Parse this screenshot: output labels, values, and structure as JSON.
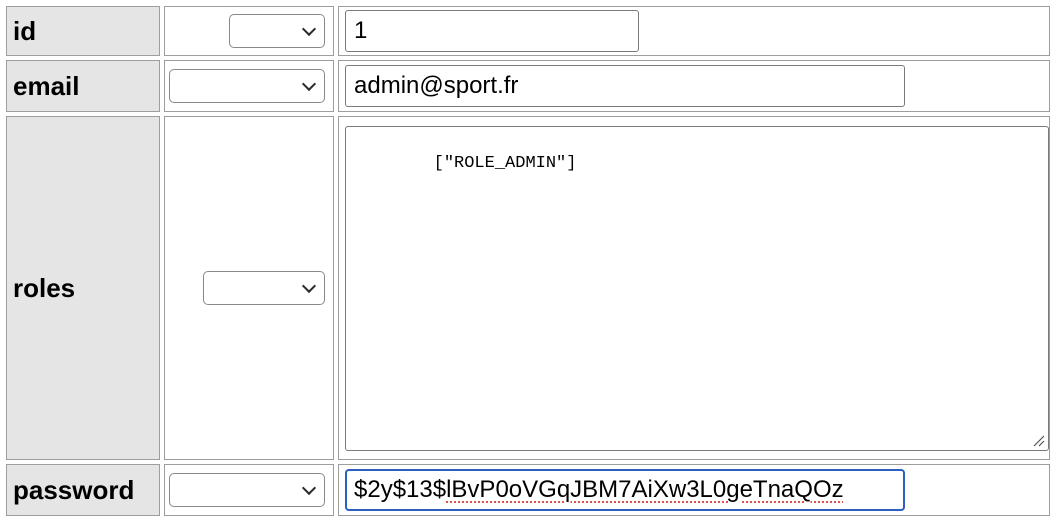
{
  "rows": [
    {
      "label": "id",
      "function_value": "",
      "value": "1"
    },
    {
      "label": "email",
      "function_value": "",
      "value": "admin@sport.fr"
    },
    {
      "label": "roles",
      "function_value": "",
      "value": "[\"ROLE_ADMIN\"]"
    },
    {
      "label": "password",
      "function_value": "",
      "value_prefix": "$2y$13$",
      "value_rest": "lBvP0oVGqJBM7AiXw3L0geTnaQOz"
    }
  ]
}
